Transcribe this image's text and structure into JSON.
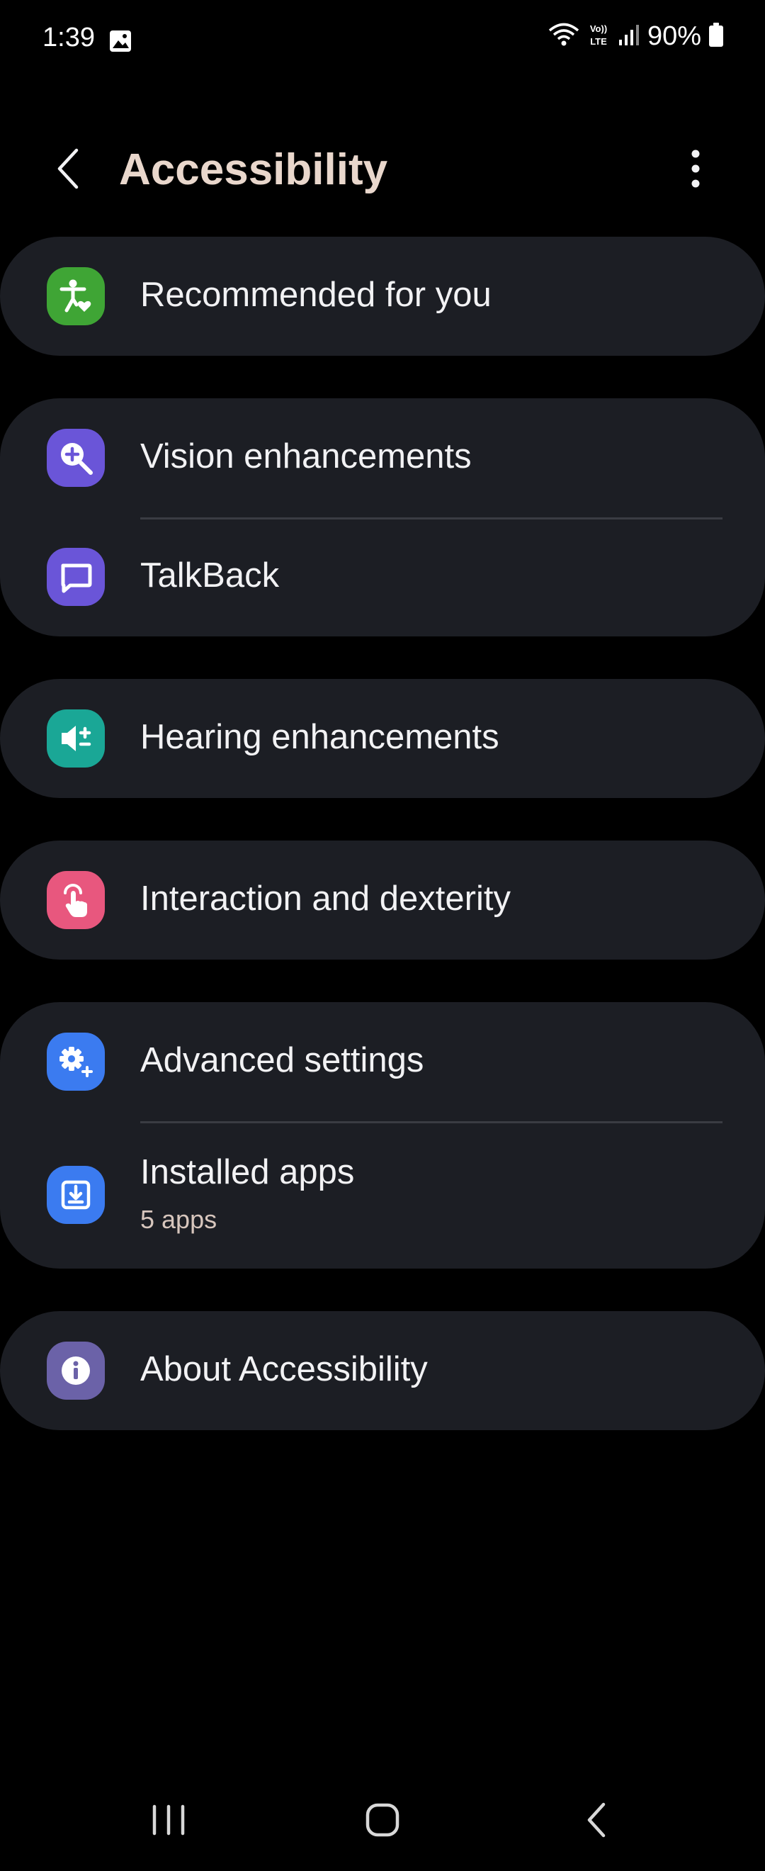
{
  "status_bar": {
    "time": "1:39",
    "battery": "90%",
    "icons": [
      "gallery-icon",
      "wifi-icon",
      "volte-icon",
      "signal-icon",
      "battery-icon"
    ]
  },
  "header": {
    "title": "Accessibility",
    "back_icon": "chevron-left-icon",
    "more_icon": "more-vertical-icon"
  },
  "sections": [
    {
      "items": [
        {
          "label": "Recommended for you",
          "icon": "accessibility-person-icon",
          "icon_color": "#3fa535"
        }
      ]
    },
    {
      "items": [
        {
          "label": "Vision enhancements",
          "icon": "zoom-in-icon",
          "icon_color": "#6a55d8"
        },
        {
          "label": "TalkBack",
          "icon": "speech-bubble-icon",
          "icon_color": "#6a55d8"
        }
      ]
    },
    {
      "items": [
        {
          "label": "Hearing enhancements",
          "icon": "speaker-volume-icon",
          "icon_color": "#1aa796"
        }
      ]
    },
    {
      "items": [
        {
          "label": "Interaction and dexterity",
          "icon": "touch-hand-icon",
          "icon_color": "#e8577e"
        }
      ]
    },
    {
      "items": [
        {
          "label": "Advanced settings",
          "icon": "gear-plus-icon",
          "icon_color": "#3b7bf0"
        },
        {
          "label": "Installed apps",
          "sublabel": "5 apps",
          "icon": "download-icon",
          "icon_color": "#3b7bf0"
        }
      ]
    },
    {
      "items": [
        {
          "label": "About Accessibility",
          "icon": "info-icon",
          "icon_color": "#6b62a8"
        }
      ]
    }
  ],
  "nav_bar": {
    "icons": [
      "recent-apps-icon",
      "home-icon",
      "back-icon"
    ]
  }
}
